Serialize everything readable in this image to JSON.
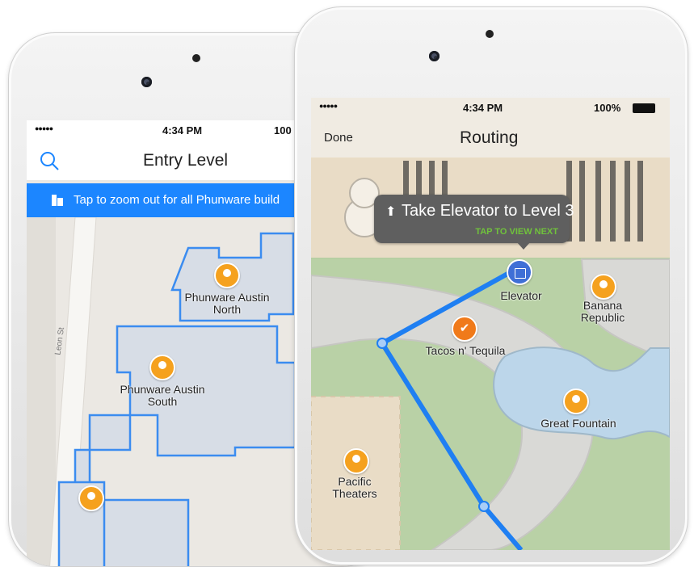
{
  "left_phone": {
    "status": {
      "signal": "●●●●●",
      "time": "4:34 PM",
      "battery": "100"
    },
    "nav": {
      "title": "Entry Level"
    },
    "banner": {
      "text": "Tap to zoom out for all Phunware build"
    },
    "map": {
      "street": "Leon St",
      "places": [
        {
          "name": "Phunware Austin North",
          "lines": [
            "Phunware Austin",
            "North"
          ]
        },
        {
          "name": "Phunware Austin South",
          "lines": [
            "Phunware Austin",
            "South"
          ]
        }
      ]
    }
  },
  "right_phone": {
    "status": {
      "signal": "●●●●●",
      "time": "4:34 PM",
      "battery": "100%"
    },
    "nav": {
      "done": "Done",
      "title": "Routing"
    },
    "callout": {
      "instruction": "Take Elevator to Level 3",
      "hint": "TAP TO VIEW NEXT"
    },
    "map": {
      "elevator": "Elevator",
      "restaurant": "Tacos n' Tequila",
      "banana_lines": [
        "Banana",
        "Republic"
      ],
      "fountain": "Great Fountain",
      "theaters_lines": [
        "Pacific",
        "Theaters"
      ]
    }
  },
  "colors": {
    "accent": "#1c86ff",
    "pin": "#f5a11e",
    "route": "#1f7ff2",
    "callout_hint": "#70c23c"
  }
}
